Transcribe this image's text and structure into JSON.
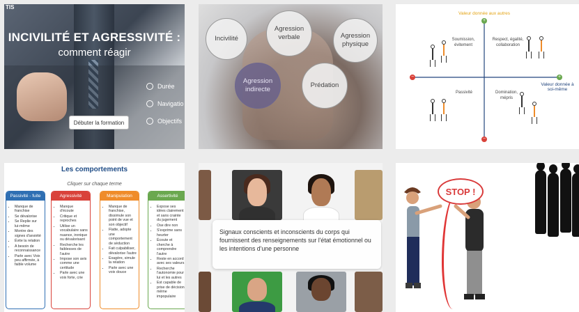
{
  "tile1": {
    "logo": "TIS",
    "title_line1": "INCIVILITÉ ET AGRESSIVITÉ :",
    "title_line2": "comment réagir",
    "menu": [
      {
        "icon": "timer-icon",
        "label": "Durée"
      },
      {
        "icon": "compass-icon",
        "label": "Navigatio"
      },
      {
        "icon": "target-icon",
        "label": "Objectifs"
      }
    ],
    "start_button": "Débuter la formation"
  },
  "tile2": {
    "bubbles": [
      "Incivilité",
      "Agression verbale",
      "Agression physique",
      "Agression indirecte",
      "Prédation"
    ]
  },
  "tile3": {
    "y_axis": "Valeur donnée aux autres",
    "x_axis": "Valeur donnée à soi-même",
    "q_top_left": "Soumission, évitement",
    "q_top_right": "Respect, égalité, collaboration",
    "q_bottom_left": "Passivité",
    "q_bottom_right": "Domination, mépris",
    "plus": "+",
    "minus": "−"
  },
  "tile4": {
    "title": "Les comportements",
    "subtitle": "Cliquer sur chaque terme",
    "columns": [
      {
        "header": "Passivité - fuite",
        "color": "#2f6fb3",
        "items": [
          "Manque de franchise",
          "Se dévalorise",
          "Se Replie sur lui-même",
          "Montre des signes d'anxiété",
          "Évite la relation",
          "A besoin de reconnaissance",
          "Parle avec Voix peu affirmée, à faible volume"
        ]
      },
      {
        "header": "Agressivité",
        "color": "#d9423a",
        "items": [
          "Manque d'écoute",
          "Critique et reproches",
          "Utilise un vocabulaire sans nuance, ironique ou dévalorisant",
          "Recherche les faiblesses de l'autre",
          "Impose son avis comme une certitude",
          "Parle avec une voix forte, crie"
        ]
      },
      {
        "header": "Manipulation",
        "color": "#ef8c2a",
        "items": [
          "Manque de franchise, dissimule son point de vue et son objectif",
          "Flatte, adopte une comportement de séduction",
          "Fait culpabiliser, dévalorise l'autre",
          "Exagère, simule la relation",
          "Parle avec une voix douce"
        ]
      },
      {
        "header": "Assertivité",
        "color": "#6aa84f",
        "items": [
          "Expose ses idées clairement et sans crainte du jugement",
          "Ose dire non",
          "S'exprime sans heurter",
          "Écoute et cherche à comprendre l'autre",
          "Reste en accord avec ses valeurs",
          "Recherche l'autonomie pour lui et les autres",
          "Est capable de prise de décision même impopulaire"
        ]
      }
    ]
  },
  "tile5": {
    "text": "Signaux conscients et inconscients du corps qui fournissent des renseignements sur l'état émotionnel ou les intentions d'une personne"
  },
  "tile6": {
    "stop": "STOP !"
  }
}
